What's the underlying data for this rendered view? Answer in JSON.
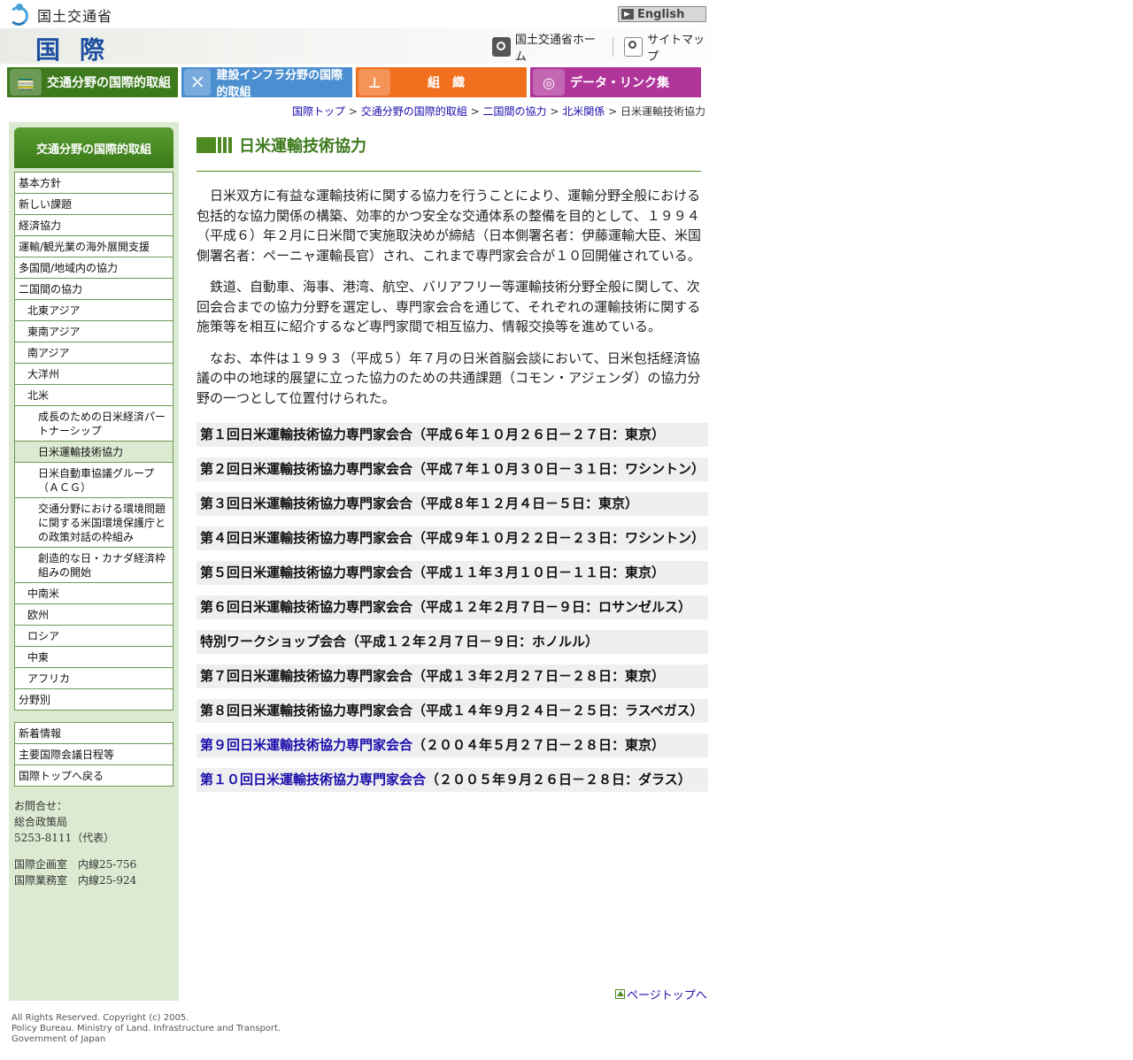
{
  "header": {
    "ministry_name": "国土交通省",
    "english_label": "English",
    "banner_title": "国際",
    "links": {
      "home": "国土交通省ホーム",
      "sitemap": "サイトマップ"
    }
  },
  "tabs": [
    {
      "label": "交通分野の国際的取組",
      "icon": "train-icon"
    },
    {
      "label": "建設インフラ分野の国際的取組",
      "icon": "road-icon"
    },
    {
      "label": "組　織",
      "icon": "org-chart-icon"
    },
    {
      "label": "データ・リンク集",
      "icon": "globe-icon"
    }
  ],
  "breadcrumb": {
    "items": [
      "国際トップ",
      "交通分野の国際的取組",
      "二国間の協力",
      "北米関係"
    ],
    "current": "日米運輸技術協力",
    "separator": ">"
  },
  "sidebar": {
    "heading": "交通分野の国際的取組",
    "menu": [
      {
        "label": "基本方針"
      },
      {
        "label": "新しい課題"
      },
      {
        "label": "経済協力"
      },
      {
        "label": "運輸/観光業の海外展開支援"
      },
      {
        "label": "多国間/地域内の協力"
      },
      {
        "label": "二国間の協力"
      },
      {
        "label": "北東アジア"
      },
      {
        "label": "東南アジア"
      },
      {
        "label": "南アジア"
      },
      {
        "label": "大洋州"
      },
      {
        "label": "北米"
      },
      {
        "label": "成長のための日米経済パートナーシップ"
      },
      {
        "label": "日米運輸技術協力"
      },
      {
        "label": "日米自動車協議グループ（ＡＣＧ）"
      },
      {
        "label": "交通分野における環境問題に関する米国環境保護庁との政策対話の枠組み"
      },
      {
        "label": "創造的な日・カナダ経済枠組みの開始"
      },
      {
        "label": "中南米"
      },
      {
        "label": "欧州"
      },
      {
        "label": "ロシア"
      },
      {
        "label": "中東"
      },
      {
        "label": "アフリカ"
      },
      {
        "label": "分野別"
      }
    ],
    "menu2": [
      {
        "label": "新着情報"
      },
      {
        "label": "主要国際会議日程等"
      },
      {
        "label": "国際トップへ戻る"
      }
    ],
    "contact": {
      "title": "お問合せ：",
      "dept": "総合政策局",
      "phone": "5253-8111（代表）",
      "office1": "国際企画室　内線25-756",
      "office2": "国際業務室　内線25-924"
    }
  },
  "main": {
    "title": "日米運輸技術協力",
    "paragraphs": [
      "日米双方に有益な運輸技術に関する協力を行うことにより、運輸分野全般における包括的な協力関係の構築、効率的かつ安全な交通体系の整備を目的として、１９９４（平成６）年２月に日米間で実施取決めが締結（日本側署名者：伊藤運輸大臣、米国側署名者：ペーニャ運輸長官）され、これまで専門家会合が１０回開催されている。",
      "鉄道、自動車、海事、港湾、航空、バリアフリー等運輸技術分野全般に関して、次回会合までの協力分野を選定し、専門家会合を通じて、それぞれの運輸技術に関する施策等を相互に紹介するなど専門家間で相互協力、情報交換等を進めている。",
      "なお、本件は１９９３（平成５）年７月の日米首脳会談において、日米包括経済協議の中の地球的展望に立った協力のための共通課題（コモン・アジェンダ）の協力分野の一つとして位置付けられた。"
    ],
    "meetings": [
      {
        "text": "第１回日米運輸技術協力専門家会合（平成６年１０月２６日－２７日：東京）"
      },
      {
        "text": "第２回日米運輸技術協力専門家会合（平成７年１０月３０日－３１日：ワシントン）"
      },
      {
        "text": "第３回日米運輸技術協力専門家会合（平成８年１２月４日－５日：東京）"
      },
      {
        "text": "第４回日米運輸技術協力専門家会合（平成９年１０月２２日－２３日：ワシントン）"
      },
      {
        "text": "第５回日米運輸技術協力専門家会合（平成１１年３月１０日－１１日：東京）"
      },
      {
        "text": "第６回日米運輸技術協力専門家会合（平成１２年２月７日－９日：ロサンゼルス）"
      },
      {
        "text": "特別ワークショップ会合（平成１２年２月７日－９日：ホノルル）"
      },
      {
        "text": "第７回日米運輸技術協力専門家会合（平成１３年２月２７日－２８日：東京）"
      },
      {
        "text": "第８回日米運輸技術協力専門家会合（平成１４年９月２４日－２５日：ラスベガス）"
      },
      {
        "link": "第９回日米運輸技術協力専門家会合",
        "text": "（２００４年５月２７日－２８日：東京）"
      },
      {
        "link": "第１０回日米運輸技術協力専門家会合",
        "text": "（２００５年９月２６日－２８日：ダラス）"
      }
    ],
    "page_top": "ページトップへ"
  },
  "footer": {
    "line1": "All Rights Reserved. Copyright (c) 2005.",
    "line2": "Policy Bureau. Ministry of Land. Infrastructure and Transport.",
    "line3": "Government of Japan"
  }
}
